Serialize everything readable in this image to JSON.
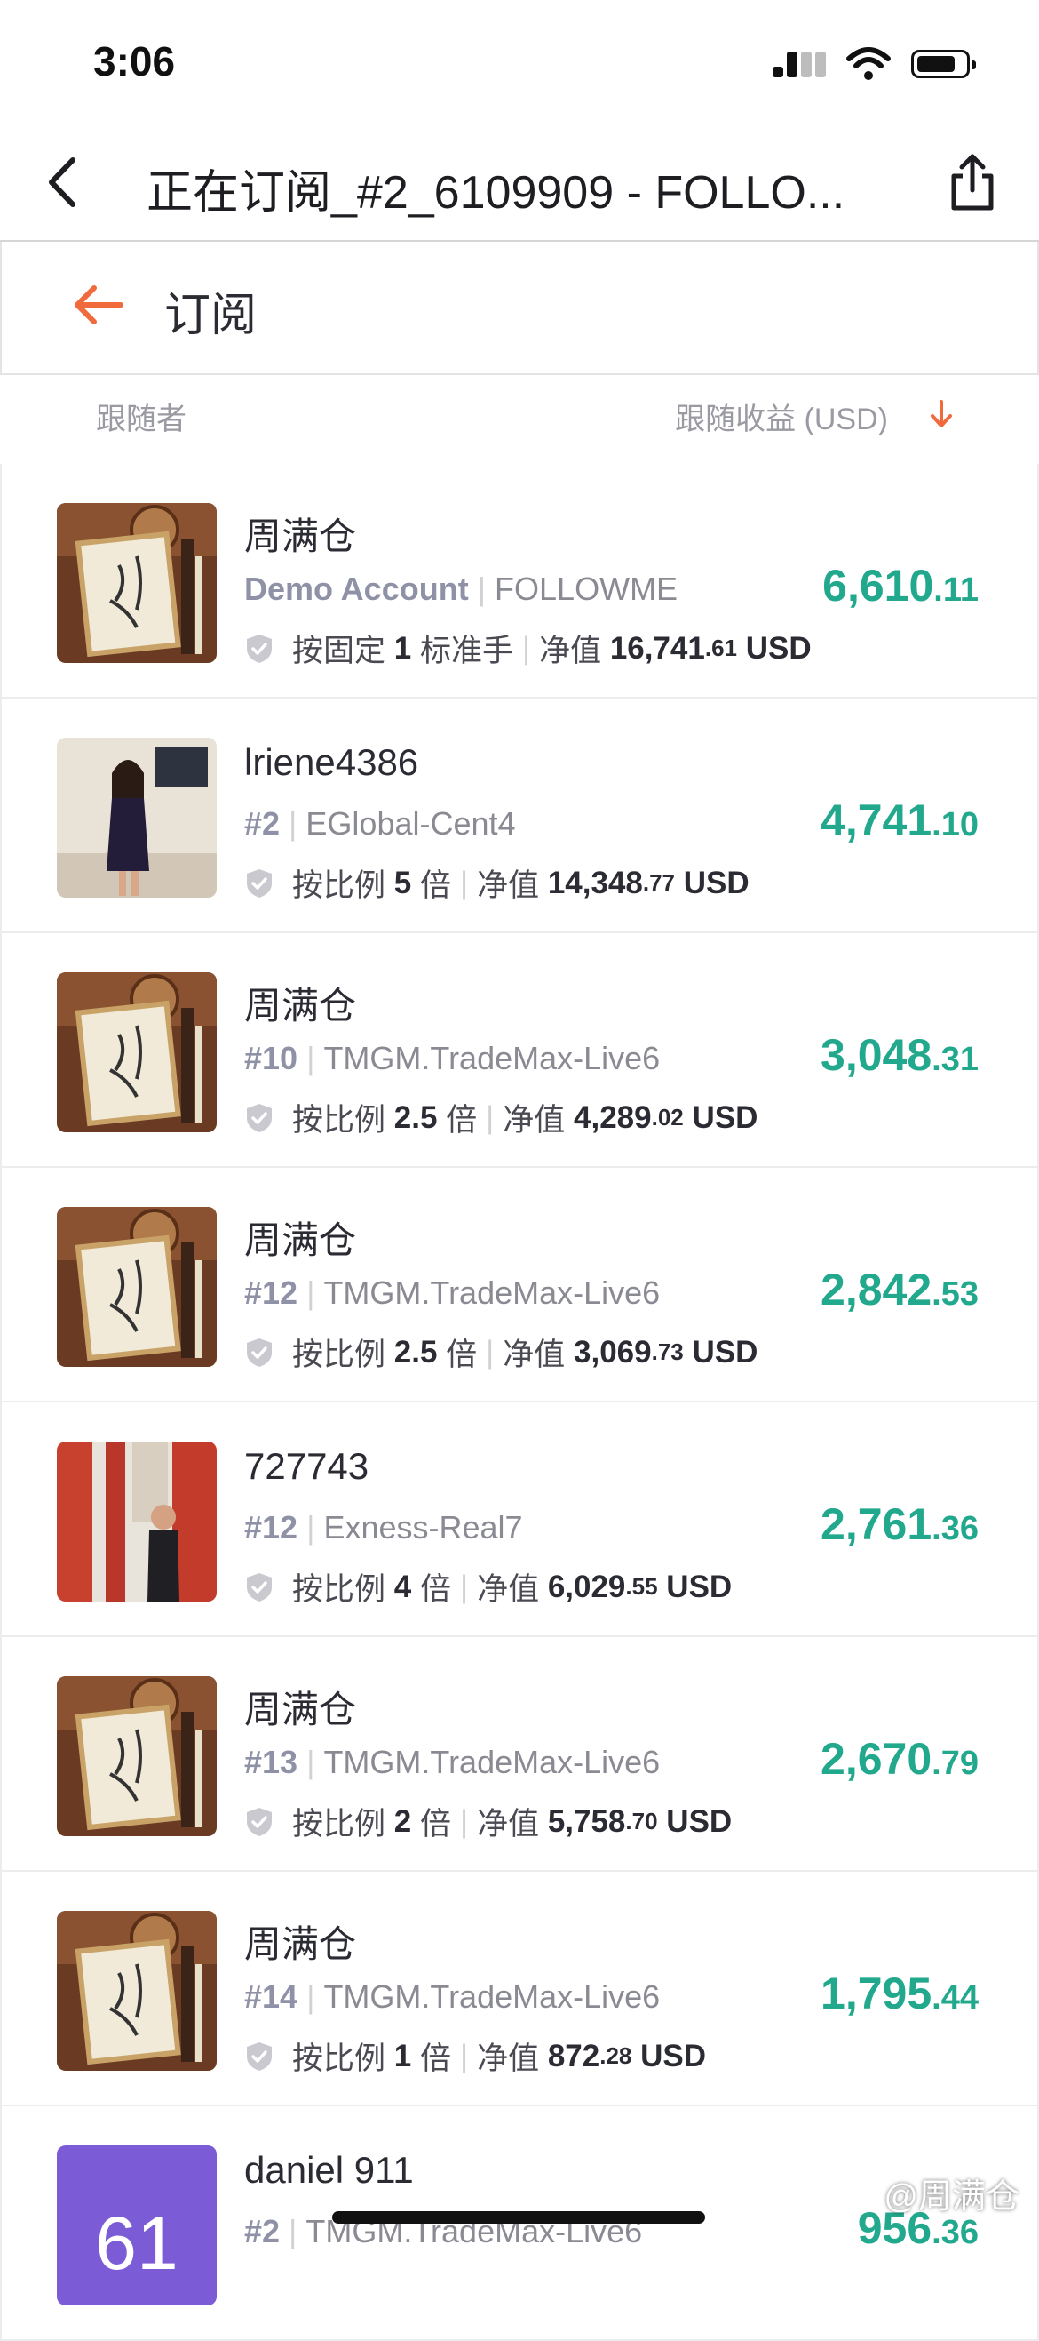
{
  "status": {
    "time": "3:06"
  },
  "nav": {
    "title": "正在订阅_#2_6109909 - FOLLO..."
  },
  "sub_header": {
    "title": "订阅"
  },
  "columns": {
    "left": "跟随者",
    "right": "跟随收益 (USD)"
  },
  "watermark": "@周满仓",
  "colors": {
    "accent": "#f06a3c",
    "profit": "#22a88c"
  },
  "rows": [
    {
      "name": "周满仓",
      "account": "Demo Account",
      "server": "FOLLOWME",
      "mode": "按固定",
      "factor": "1",
      "unit": "标准手",
      "equity_label": "净值",
      "equity_int": "16,741",
      "equity_dec": ".61",
      "currency": "USD",
      "profit_int": "6,610",
      "profit_dec": ".11"
    },
    {
      "name": "lriene4386",
      "account": "#2",
      "server": "EGlobal-Cent4",
      "mode": "按比例",
      "factor": "5",
      "unit": "倍",
      "equity_label": "净值",
      "equity_int": "14,348",
      "equity_dec": ".77",
      "currency": "USD",
      "profit_int": "4,741",
      "profit_dec": ".10"
    },
    {
      "name": "周满仓",
      "account": "#10",
      "server": "TMGM.TradeMax-Live6",
      "mode": "按比例",
      "factor": "2.5",
      "unit": "倍",
      "equity_label": "净值",
      "equity_int": "4,289",
      "equity_dec": ".02",
      "currency": "USD",
      "profit_int": "3,048",
      "profit_dec": ".31"
    },
    {
      "name": "周满仓",
      "account": "#12",
      "server": "TMGM.TradeMax-Live6",
      "mode": "按比例",
      "factor": "2.5",
      "unit": "倍",
      "equity_label": "净值",
      "equity_int": "3,069",
      "equity_dec": ".73",
      "currency": "USD",
      "profit_int": "2,842",
      "profit_dec": ".53"
    },
    {
      "name": "727743",
      "account": "#12",
      "server": "Exness-Real7",
      "mode": "按比例",
      "factor": "4",
      "unit": "倍",
      "equity_label": "净值",
      "equity_int": "6,029",
      "equity_dec": ".55",
      "currency": "USD",
      "profit_int": "2,761",
      "profit_dec": ".36"
    },
    {
      "name": "周满仓",
      "account": "#13",
      "server": "TMGM.TradeMax-Live6",
      "mode": "按比例",
      "factor": "2",
      "unit": "倍",
      "equity_label": "净值",
      "equity_int": "5,758",
      "equity_dec": ".70",
      "currency": "USD",
      "profit_int": "2,670",
      "profit_dec": ".79"
    },
    {
      "name": "周满仓",
      "account": "#14",
      "server": "TMGM.TradeMax-Live6",
      "mode": "按比例",
      "factor": "1",
      "unit": "倍",
      "equity_label": "净值",
      "equity_int": "872",
      "equity_dec": ".28",
      "currency": "USD",
      "profit_int": "1,795",
      "profit_dec": ".44"
    },
    {
      "name": "daniel 911",
      "account": "#2",
      "server": "TMGM.TradeMax-Live6",
      "profit_int": "956",
      "profit_dec": ".36",
      "avatar_text": "61"
    }
  ]
}
